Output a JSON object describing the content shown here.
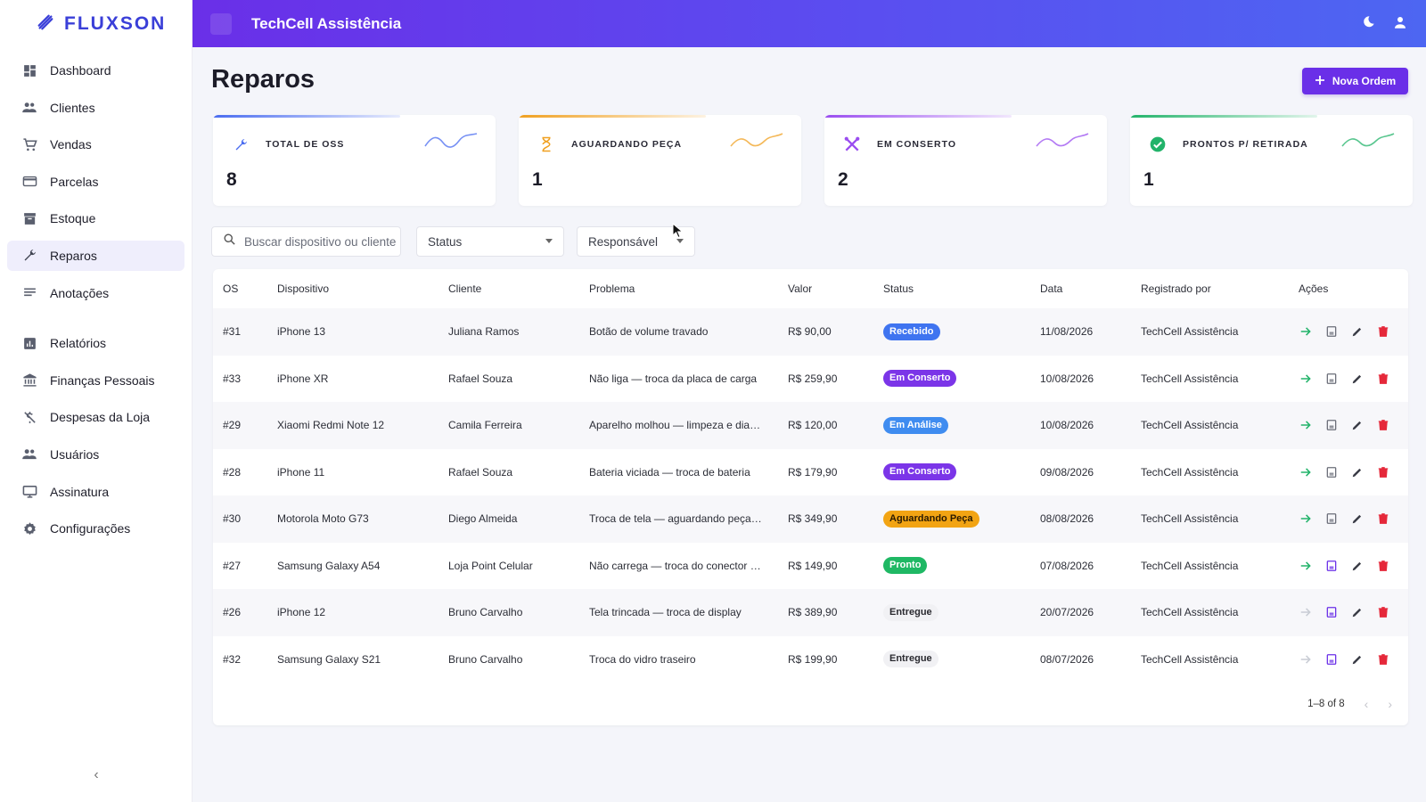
{
  "brand": {
    "name": "FLUXSON",
    "color": "#3a3fd8"
  },
  "topbar": {
    "title": "TechCell Assistência",
    "icons": [
      "moon-icon",
      "user-icon"
    ]
  },
  "sidebar": {
    "items": [
      {
        "label": "Dashboard",
        "icon": "dashboard-icon"
      },
      {
        "label": "Clientes",
        "icon": "people-icon"
      },
      {
        "label": "Vendas",
        "icon": "cart-icon"
      },
      {
        "label": "Parcelas",
        "icon": "card-icon"
      },
      {
        "label": "Estoque",
        "icon": "inventory-icon"
      },
      {
        "label": "Reparos",
        "icon": "wrench-icon",
        "active": true
      },
      {
        "label": "Anotações",
        "icon": "notes-icon"
      },
      {
        "label": "Relatórios",
        "icon": "chart-icon"
      },
      {
        "label": "Finanças Pessoais",
        "icon": "bank-icon"
      },
      {
        "label": "Despesas da Loja",
        "icon": "money-off-icon"
      },
      {
        "label": "Usuários",
        "icon": "people-icon"
      },
      {
        "label": "Assinatura",
        "icon": "monitor-icon"
      },
      {
        "label": "Configurações",
        "icon": "gear-icon"
      }
    ],
    "collapse_symbol": "‹"
  },
  "page": {
    "title": "Reparos",
    "new_button": "Nova Ordem",
    "accent": "#6a2fe8"
  },
  "cards": [
    {
      "label": "TOTAL DE OSS",
      "value": "8",
      "color": "#4a6cf0",
      "icon": "wrench-icon"
    },
    {
      "label": "AGUARDANDO PEÇA",
      "value": "1",
      "color": "#f0a020",
      "icon": "hourglass-icon"
    },
    {
      "label": "EM CONSERTO",
      "value": "2",
      "color": "#9a4df0",
      "icon": "tools-icon"
    },
    {
      "label": "PRONTOS P/ RETIRADA",
      "value": "1",
      "color": "#22b36a",
      "icon": "check-circle-icon"
    }
  ],
  "filters": {
    "search_placeholder": "Buscar dispositivo ou cliente",
    "status_label": "Status",
    "responsavel_label": "Responsável"
  },
  "table": {
    "headers": [
      "OS",
      "Dispositivo",
      "Cliente",
      "Problema",
      "Valor",
      "Status",
      "Data",
      "Registrado por",
      "Ações"
    ],
    "rows": [
      {
        "os": "#31",
        "dev": "iPhone 13",
        "cli": "Juliana Ramos",
        "prob": "Botão de volume travado",
        "val": "R$ 90,00",
        "status": "Recebido",
        "date": "11/08/2026",
        "reg": "TechCell Assistência"
      },
      {
        "os": "#33",
        "dev": "iPhone XR",
        "cli": "Rafael Souza",
        "prob": "Não liga — troca da placa de carga",
        "val": "R$ 259,90",
        "status": "Em Conserto",
        "date": "10/08/2026",
        "reg": "TechCell Assistência"
      },
      {
        "os": "#29",
        "dev": "Xiaomi Redmi Note 12",
        "cli": "Camila Ferreira",
        "prob": "Aparelho molhou — limpeza e diagnóstico",
        "val": "R$ 120,00",
        "status": "Em Análise",
        "date": "10/08/2026",
        "reg": "TechCell Assistência"
      },
      {
        "os": "#28",
        "dev": "iPhone 11",
        "cli": "Rafael Souza",
        "prob": "Bateria viciada — troca de bateria",
        "val": "R$ 179,90",
        "status": "Em Conserto",
        "date": "09/08/2026",
        "reg": "TechCell Assistência"
      },
      {
        "os": "#30",
        "dev": "Motorola Moto G73",
        "cli": "Diego Almeida",
        "prob": "Troca de tela — aguardando peça chegar",
        "val": "R$ 349,90",
        "status": "Aguardando Peça",
        "date": "08/08/2026",
        "reg": "TechCell Assistência"
      },
      {
        "os": "#27",
        "dev": "Samsung Galaxy A54",
        "cli": "Loja Point Celular",
        "prob": "Não carrega — troca do conector de carga",
        "val": "R$ 149,90",
        "status": "Pronto",
        "date": "07/08/2026",
        "reg": "TechCell Assistência"
      },
      {
        "os": "#26",
        "dev": "iPhone 12",
        "cli": "Bruno Carvalho",
        "prob": "Tela trincada — troca de display",
        "val": "R$ 389,90",
        "status": "Entregue",
        "date": "20/07/2026",
        "reg": "TechCell Assistência"
      },
      {
        "os": "#32",
        "dev": "Samsung Galaxy S21",
        "cli": "Bruno Carvalho",
        "prob": "Troca do vidro traseiro",
        "val": "R$ 199,90",
        "status": "Entregue",
        "date": "08/07/2026",
        "reg": "TechCell Assistência"
      }
    ],
    "pager": "1–8 of 8"
  },
  "status_colors": {
    "Recebido": {
      "bg": "#3f74f0",
      "fg": "#ffffff"
    },
    "Em Conserto": {
      "bg": "#7b35e8",
      "fg": "#ffffff"
    },
    "Em Análise": {
      "bg": "#3f8cf0",
      "fg": "#ffffff"
    },
    "Aguardando Peça": {
      "bg": "#f2a413",
      "fg": "#2a1a00"
    },
    "Pronto": {
      "bg": "#1fb864",
      "fg": "#ffffff"
    },
    "Entregue": {
      "bg": "#f1f1f4",
      "fg": "#2a2a30"
    }
  }
}
